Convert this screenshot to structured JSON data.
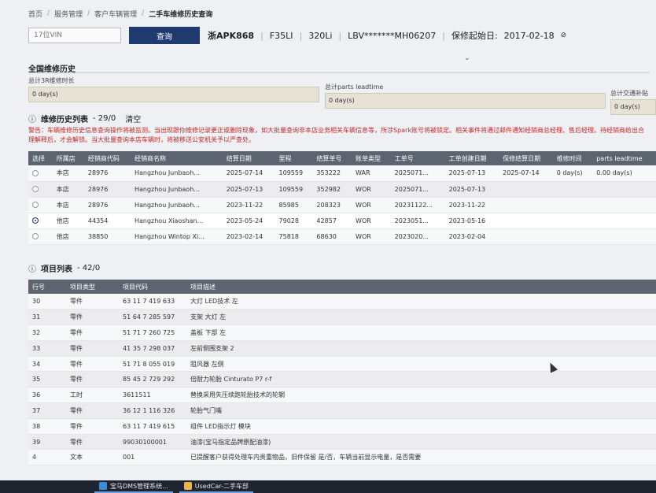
{
  "breadcrumb": [
    "首页",
    "服务管理",
    "客户车辆管理",
    "二手车维修历史查询"
  ],
  "search": {
    "placeholder": "17位VIN",
    "button": "查询"
  },
  "vehicle": {
    "plate": "浙APK868",
    "series": "F35LI",
    "model": "320Li",
    "vin": "LBV*******MH06207",
    "warranty_label": "保修起始日:",
    "warranty_date": "2017-02-18"
  },
  "global_section": {
    "title": "全国维修历史"
  },
  "stats": [
    {
      "label": "总计3R维修时长",
      "value": "0 day(s)"
    },
    {
      "label": "总计parts leadtime",
      "value": "0 day(s)"
    },
    {
      "label": "总计交通补贴",
      "value": "0 day(s)"
    }
  ],
  "history": {
    "title": "维修历史列表",
    "count": "- 29/0",
    "clear": "清空",
    "warning": "警告：车辆维修历史信息查询操作将被监测。当出现跟你维修记录更正或删除现象，如大批量查询非本店业务相关车辆信息等，所涉Spark账号将被锁定。相关事件将通过邮件通知经销商总经理、售后经理。待经销商给出合理解释后，才会解锁。当大批量查询本店车辆时，将被移送公安机关予以严查处。",
    "columns": [
      "选择",
      "所属店",
      "经销商代码",
      "经销商名称",
      "结算日期",
      "里程",
      "结算单号",
      "账单类型",
      "工单号",
      "工单创建日期",
      "保修结算日期",
      "维修时间",
      "parts leadtime"
    ],
    "rows": [
      {
        "store": "本店",
        "code": "28976",
        "name": "Hangzhou Junbaoh...",
        "settle": "2025-07-14",
        "mileage": "109559",
        "bill": "353222",
        "type": "WAR",
        "wo": "2025071...",
        "wodate": "2025-07-13",
        "wardate": "2025-07-14",
        "time": "0 day(s)",
        "lead": "0.00 day(s)",
        "selected": false
      },
      {
        "store": "本店",
        "code": "28976",
        "name": "Hangzhou Junbaoh...",
        "settle": "2025-07-13",
        "mileage": "109559",
        "bill": "352982",
        "type": "WOR",
        "wo": "2025071...",
        "wodate": "2025-07-13",
        "wardate": "",
        "time": "",
        "lead": "",
        "selected": false
      },
      {
        "store": "本店",
        "code": "28976",
        "name": "Hangzhou Junbaoh...",
        "settle": "2023-11-22",
        "mileage": "85985",
        "bill": "208323",
        "type": "WOR",
        "wo": "20231122...",
        "wodate": "2023-11-22",
        "wardate": "",
        "time": "",
        "lead": "",
        "selected": false
      },
      {
        "store": "他店",
        "code": "44354",
        "name": "Hangzhou Xiaoshan...",
        "settle": "2023-05-24",
        "mileage": "79028",
        "bill": "42857",
        "type": "WOR",
        "wo": "2023051...",
        "wodate": "2023-05-16",
        "wardate": "",
        "time": "",
        "lead": "",
        "selected": true
      },
      {
        "store": "他店",
        "code": "38850",
        "name": "Hangzhou Wintop Xi...",
        "settle": "2023-02-14",
        "mileage": "75818",
        "bill": "68630",
        "type": "WOR",
        "wo": "2023020...",
        "wodate": "2023-02-04",
        "wardate": "",
        "time": "",
        "lead": "",
        "selected": false
      }
    ]
  },
  "items": {
    "title": "项目列表",
    "count": "- 42/0",
    "columns": [
      "行号",
      "项目类型",
      "项目代码",
      "项目描述"
    ],
    "rows": [
      {
        "no": "30",
        "type": "零件",
        "code": "63 11 7 419 633",
        "desc": "大灯 LED技术 左"
      },
      {
        "no": "31",
        "type": "零件",
        "code": "51 64 7 285 597",
        "desc": "支架 大灯 左"
      },
      {
        "no": "32",
        "type": "零件",
        "code": "51 71 7 260 725",
        "desc": "盖板 下部 左"
      },
      {
        "no": "33",
        "type": "零件",
        "code": "41 35 7 298 037",
        "desc": "左前侧围支架 2"
      },
      {
        "no": "34",
        "type": "零件",
        "code": "51 71 8 055 019",
        "desc": "阻风器 左侧"
      },
      {
        "no": "35",
        "type": "零件",
        "code": "85 45 2 729 292",
        "desc": "倍耐力轮胎 Cinturato P7 r-f"
      },
      {
        "no": "36",
        "type": "工时",
        "code": "3611511",
        "desc": "替换采用失压续跑轮胎技术的轮辋"
      },
      {
        "no": "37",
        "type": "零件",
        "code": "36 12 1 116 326",
        "desc": "轮胎气门嘴"
      },
      {
        "no": "38",
        "type": "零件",
        "code": "63 11 7 419 615",
        "desc": "组件 LED指示灯 模块"
      },
      {
        "no": "39",
        "type": "零件",
        "code": "99030100001",
        "desc": "油漆(宝马指定品牌原配油漆)"
      },
      {
        "no": "4",
        "type": "文本",
        "code": "001",
        "desc": "已提醒客户获得处理车内贵重物品，旧件保留 是/否，车辆当前显示电量，是否需要"
      }
    ]
  },
  "taskbar": {
    "items": [
      "宝马DMS管理系统...",
      "UsedCar-二手车部"
    ]
  }
}
